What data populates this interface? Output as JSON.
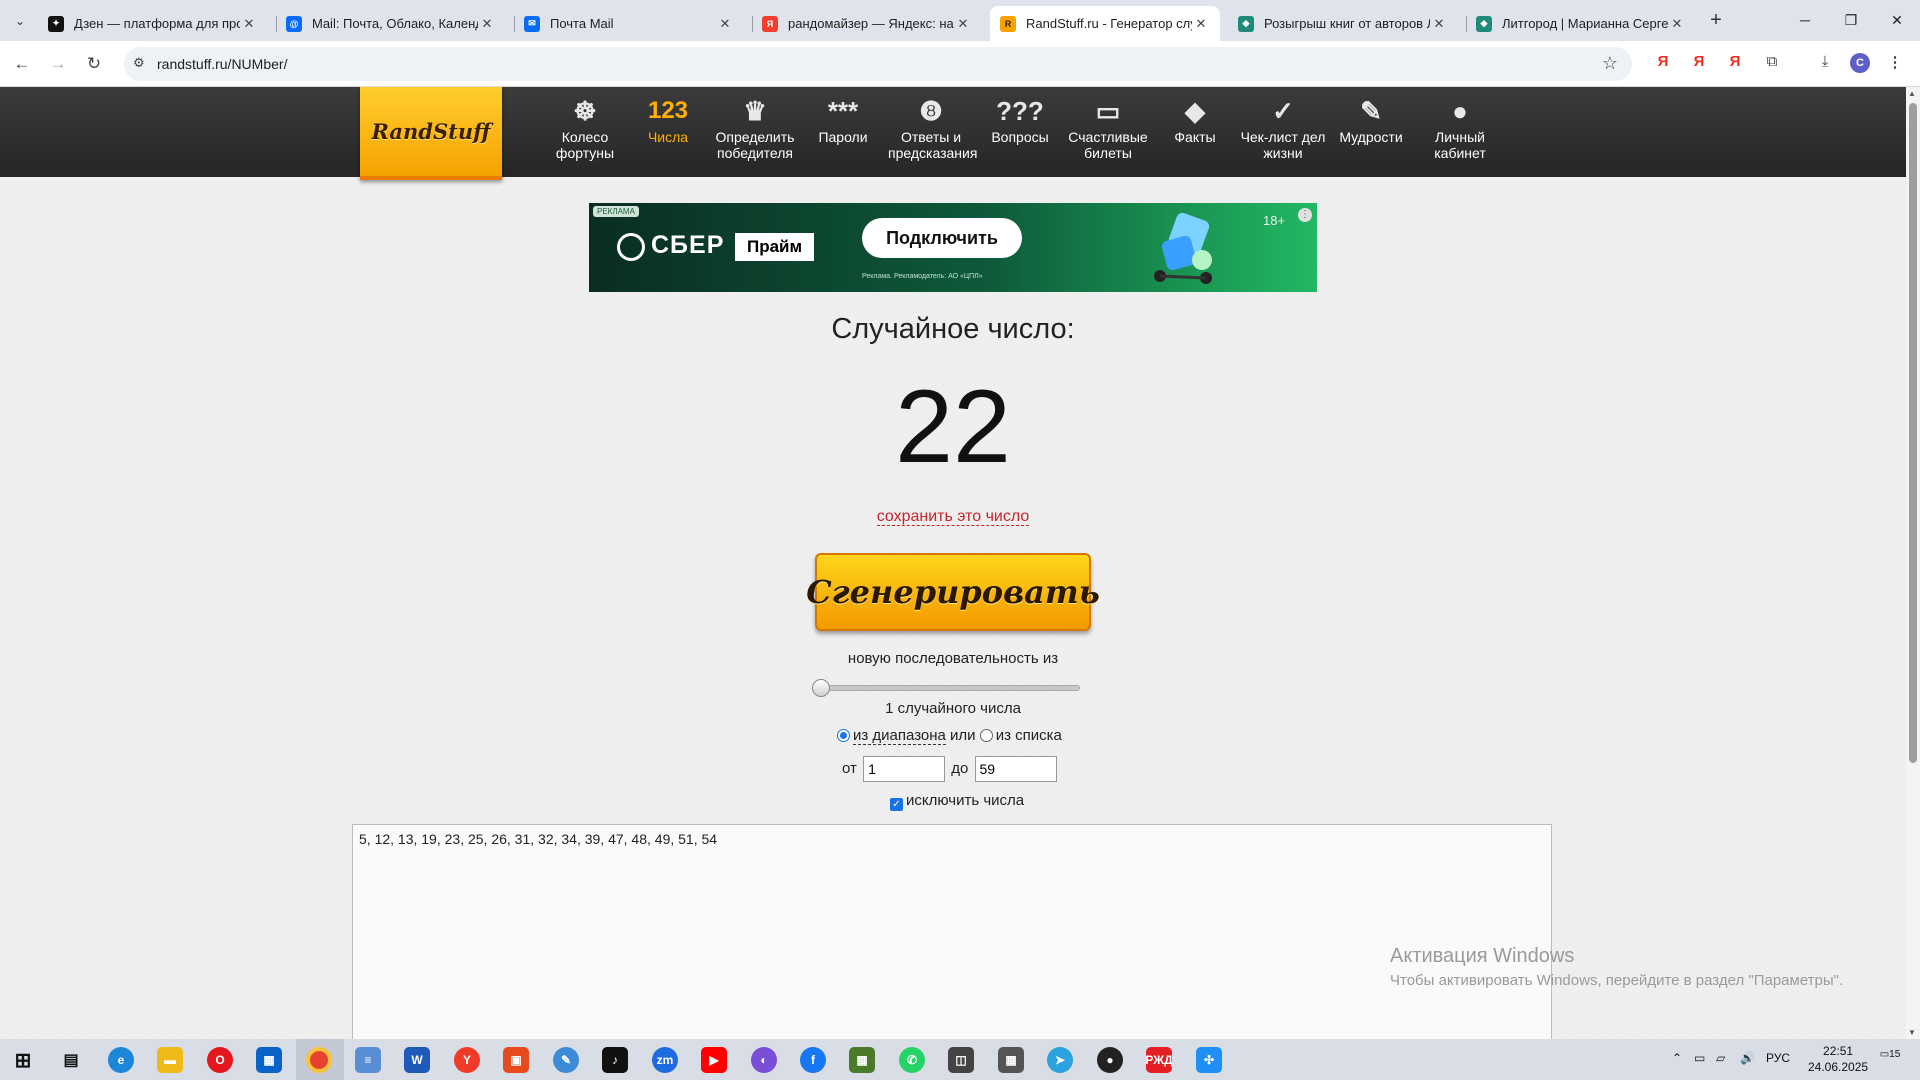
{
  "browser": {
    "tabs": [
      {
        "title": "Дзен — платформа для просм",
        "icon": "dzen-icon",
        "color": "#111111",
        "glyph": "✦"
      },
      {
        "title": "Mail: Почта, Облако, Календар",
        "icon": "mail-at-icon",
        "color": "#0a6cf5",
        "glyph": "@"
      },
      {
        "title": "Почта Mail",
        "icon": "mail-envelope-icon",
        "color": "#0a6cf5",
        "glyph": "✉"
      },
      {
        "title": "рандомайзер — Яндекс: нашл",
        "icon": "yandex-icon",
        "color": "#f33b2e",
        "glyph": "Я"
      },
      {
        "title": "RandStuff.ru - Генератор случа",
        "icon": "randstuff-icon",
        "color": "#f6a300",
        "glyph": "R"
      },
      {
        "title": "Розыгрыш книг от авторов Ли",
        "icon": "litgorod-icon",
        "color": "#1f8a7a",
        "glyph": "◆"
      },
      {
        "title": "Литгород | Марианна Сергеев",
        "icon": "litgorod-icon",
        "color": "#1f8a7a",
        "glyph": "◆"
      }
    ],
    "url": "randstuff.ru/NUMber/",
    "ext_letter": "Я",
    "profile_letter": "C"
  },
  "site": {
    "logo": "RandStuff",
    "nav": [
      {
        "label": "Колесо фортуны",
        "icon": "wheel-icon",
        "glyph": "☸"
      },
      {
        "label": "Числа",
        "icon": "numbers-icon",
        "glyph": "123",
        "active": true
      },
      {
        "label": "Определить победителя",
        "icon": "trophy-icon",
        "glyph": "🏆"
      },
      {
        "label": "Пароли",
        "icon": "password-icon",
        "glyph": "***"
      },
      {
        "label": "Ответы и предсказания",
        "icon": "eightball-icon",
        "glyph": "❽"
      },
      {
        "label": "Вопросы",
        "icon": "question-icon",
        "glyph": "???"
      },
      {
        "label": "Счастливые билеты",
        "icon": "ticket-icon",
        "glyph": "▭"
      },
      {
        "label": "Факты",
        "icon": "fact-icon",
        "glyph": "◆"
      },
      {
        "label": "Чек-лист дел жизни",
        "icon": "checklist-icon",
        "glyph": "✓"
      },
      {
        "label": "Мудрости",
        "icon": "wisdom-icon",
        "glyph": "✎"
      },
      {
        "label": "Личный кабинет",
        "icon": "user-icon",
        "glyph": "👤"
      }
    ]
  },
  "ad": {
    "tag": "РЕКЛАМА",
    "brand": "СБЕР",
    "product": "Прайм",
    "cta": "Подключить",
    "fine_print": "Реклама. Рекламодатель: АО «ЦПЛ»",
    "age": "18+"
  },
  "generator": {
    "heading": "Случайное число:",
    "result": "22",
    "save_link": "сохранить это число",
    "button": "Сгенерировать",
    "sequence_label": "новую последовательность из",
    "count_label": "1 случайного числа",
    "mode_range": "из диапазона",
    "mode_or": "или",
    "mode_list": "из списка",
    "from_label": "от",
    "from_value": "1",
    "to_label": "до",
    "to_value": "59",
    "exclude_label": "исключить числа",
    "excluded": "5, 12, 13, 19, 23, 25, 26, 31, 32, 34, 39, 47, 48, 49, 51, 54"
  },
  "watermark": {
    "line1": "Активация Windows",
    "line2": "Чтобы активировать Windows, перейдите в раздел \"Параметры\"."
  },
  "taskbar": {
    "lang": "РУС",
    "time": "22:51",
    "date": "24.06.2025",
    "notifications": "15"
  }
}
